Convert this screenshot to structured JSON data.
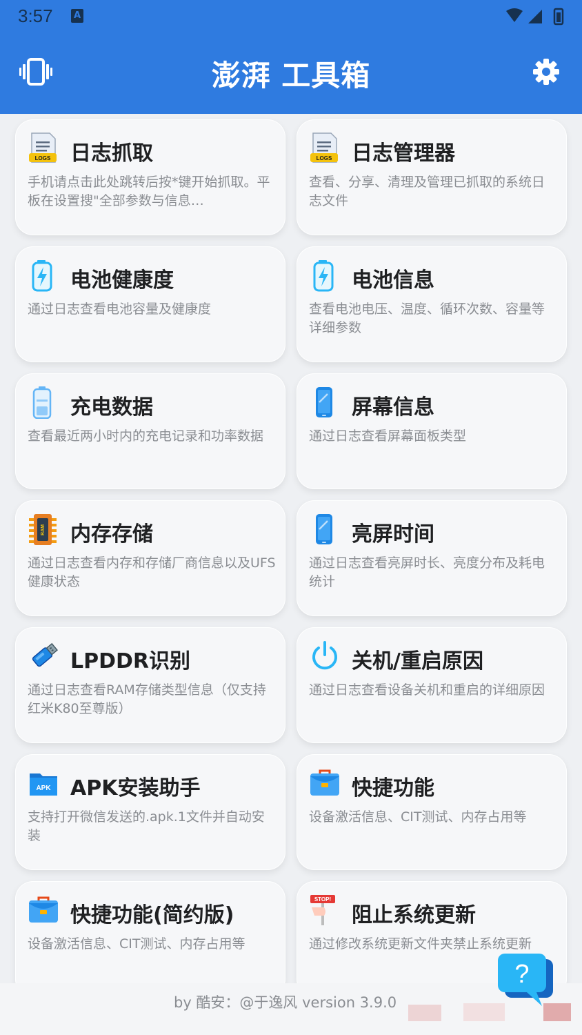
{
  "status": {
    "time": "3:57",
    "a_badge": "A"
  },
  "app": {
    "title": "澎湃 工具箱"
  },
  "cards": [
    {
      "title": "日志抓取",
      "desc": "手机请点击此处跳转后按*键开始抓取。平板在设置搜\"全部参数与信息…",
      "icon": "logs-file-icon"
    },
    {
      "title": "日志管理器",
      "desc": "查看、分享、清理及管理已抓取的系统日志文件",
      "icon": "logs-file-icon"
    },
    {
      "title": "电池健康度",
      "desc": "通过日志查看电池容量及健康度",
      "icon": "battery-bolt-icon"
    },
    {
      "title": "电池信息",
      "desc": "查看电池电压、温度、循环次数、容量等详细参数",
      "icon": "battery-bolt-icon"
    },
    {
      "title": "充电数据",
      "desc": "查看最近两小时内的充电记录和功率数据",
      "icon": "battery-icon"
    },
    {
      "title": "屏幕信息",
      "desc": "通过日志查看屏幕面板类型",
      "icon": "phone-icon"
    },
    {
      "title": "内存存储",
      "desc": "通过日志查看内存和存储厂商信息以及UFS健康状态",
      "icon": "ram-chip-icon"
    },
    {
      "title": "亮屏时间",
      "desc": "通过日志查看亮屏时长、亮度分布及耗电统计",
      "icon": "phone-icon"
    },
    {
      "title": "LPDDR识别",
      "desc": "通过日志查看RAM存储类型信息（仅支持红米K80至尊版）",
      "icon": "usb-stick-icon"
    },
    {
      "title": "关机/重启原因",
      "desc": "通过日志查看设备关机和重启的详细原因",
      "icon": "power-icon"
    },
    {
      "title": "APK安装助手",
      "desc": "支持打开微信发送的.apk.1文件并自动安装",
      "icon": "apk-folder-icon",
      "apk_badge": "APK"
    },
    {
      "title": "快捷功能",
      "desc": "设备激活信息、CIT测试、内存占用等",
      "icon": "toolbox-icon"
    },
    {
      "title": "快捷功能(简约版)",
      "desc": "设备激活信息、CIT测试、内存占用等",
      "icon": "toolbox-icon"
    },
    {
      "title": "阻止系统更新",
      "desc": "通过修改系统更新文件夹禁止系统更新",
      "icon": "stop-sign-icon",
      "stop_badge": "STOP!"
    }
  ],
  "icon_labels": {
    "logs": "LOGS",
    "ram": "RAM"
  },
  "footer": {
    "text": "by 酷安：@于逸风 version 3.9.0"
  },
  "help": {
    "glyph": "?"
  },
  "colors": {
    "primary": "#2f7be0",
    "card": "#f6f7f9",
    "title": "#1f2022",
    "desc": "#8a8d92"
  }
}
